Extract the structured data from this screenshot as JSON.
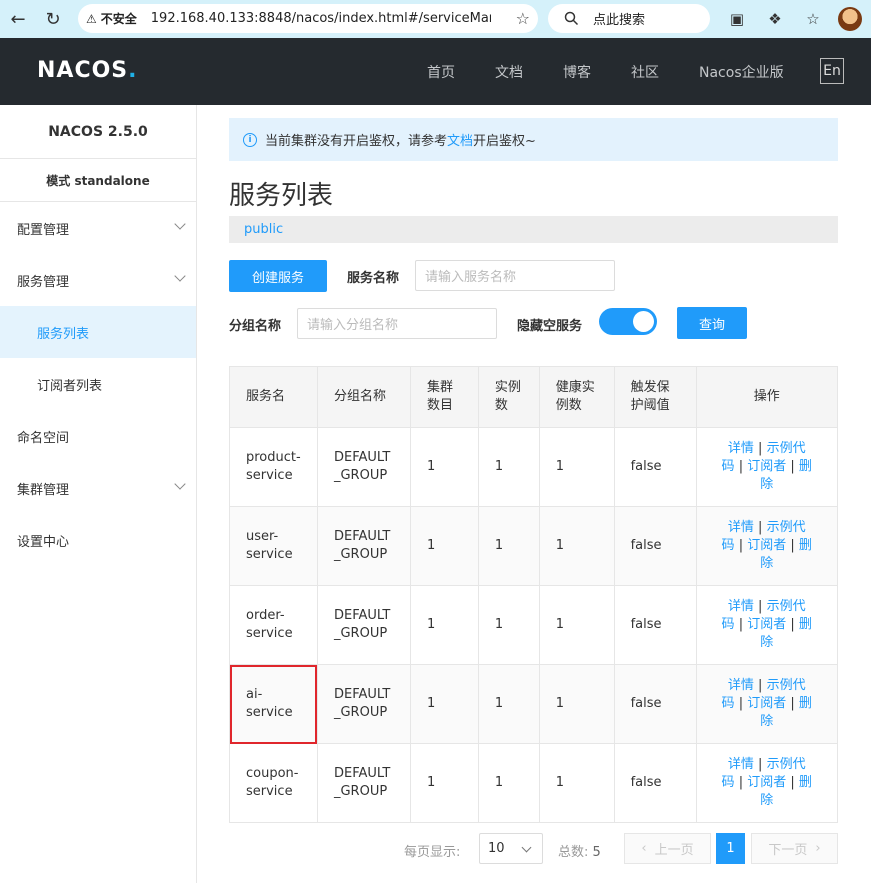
{
  "browser": {
    "security_label": "不安全",
    "url": "192.168.40.133:8848/nacos/index.html#/serviceManag...",
    "search_label": "点此搜索"
  },
  "header": {
    "logo_text": "NACOS",
    "nav": [
      "首页",
      "文档",
      "博客",
      "社区",
      "Nacos企业版"
    ],
    "lang": "En"
  },
  "sidebar": {
    "version": "NACOS 2.5.0",
    "mode": "模式 standalone",
    "items": [
      {
        "label": "配置管理",
        "expandable": true
      },
      {
        "label": "服务管理",
        "expandable": true
      },
      {
        "label": "服务列表",
        "sub": true,
        "active": true
      },
      {
        "label": "订阅者列表",
        "sub": true
      },
      {
        "label": "命名空间"
      },
      {
        "label": "集群管理",
        "expandable": true
      },
      {
        "label": "设置中心"
      }
    ]
  },
  "notice": {
    "before": "当前集群没有开启鉴权，请参考",
    "link": "文档",
    "after": "开启鉴权~"
  },
  "page": {
    "title": "服务列表",
    "namespace": "public"
  },
  "filters": {
    "create_button": "创建服务",
    "service_name_label": "服务名称",
    "service_name_placeholder": "请输入服务名称",
    "group_name_label": "分组名称",
    "group_name_placeholder": "请输入分组名称",
    "hide_empty_label": "隐藏空服务",
    "hide_empty_on": true,
    "query_button": "查询"
  },
  "table": {
    "headers": [
      "服务名",
      "分组名称",
      "集群数目",
      "实例数",
      "健康实例数",
      "触发保护阈值",
      "操作"
    ],
    "header_lines": [
      [
        "服务名"
      ],
      [
        "分组名称"
      ],
      [
        "集群",
        "数目"
      ],
      [
        "实例",
        "数"
      ],
      [
        "健康实",
        "例数"
      ],
      [
        "触发保",
        "护阈值"
      ],
      [
        "操作"
      ]
    ],
    "rows": [
      {
        "name": [
          "product-",
          "service"
        ],
        "group": [
          "DEFAULT",
          "_GROUP"
        ],
        "clusters": "1",
        "instances": "1",
        "healthy": "1",
        "threshold": "false",
        "highlight": false
      },
      {
        "name": [
          "user-",
          "service"
        ],
        "group": [
          "DEFAULT",
          "_GROUP"
        ],
        "clusters": "1",
        "instances": "1",
        "healthy": "1",
        "threshold": "false",
        "highlight": false
      },
      {
        "name": [
          "order-",
          "service"
        ],
        "group": [
          "DEFAULT",
          "_GROUP"
        ],
        "clusters": "1",
        "instances": "1",
        "healthy": "1",
        "threshold": "false",
        "highlight": false
      },
      {
        "name": [
          "ai-",
          "service"
        ],
        "group": [
          "DEFAULT",
          "_GROUP"
        ],
        "clusters": "1",
        "instances": "1",
        "healthy": "1",
        "threshold": "false",
        "highlight": true
      },
      {
        "name": [
          "coupon-",
          "service"
        ],
        "group": [
          "DEFAULT",
          "_GROUP"
        ],
        "clusters": "1",
        "instances": "1",
        "healthy": "1",
        "threshold": "false",
        "highlight": false
      }
    ],
    "ops": {
      "detail": "详情",
      "sample_a": "示例代",
      "sample_b": "码",
      "subscriber": "订阅者",
      "del_a": "删",
      "del_b": "除",
      "sep": "|"
    }
  },
  "pagination": {
    "per_page_label": "每页显示:",
    "per_page_value": "10",
    "total_label": "总数:",
    "total": "5",
    "prev": "上一页",
    "current": "1",
    "next": "下一页"
  },
  "colors": {
    "primary": "#209bfa",
    "header_bg": "#252a2f",
    "highlight_border": "#e0262c"
  }
}
